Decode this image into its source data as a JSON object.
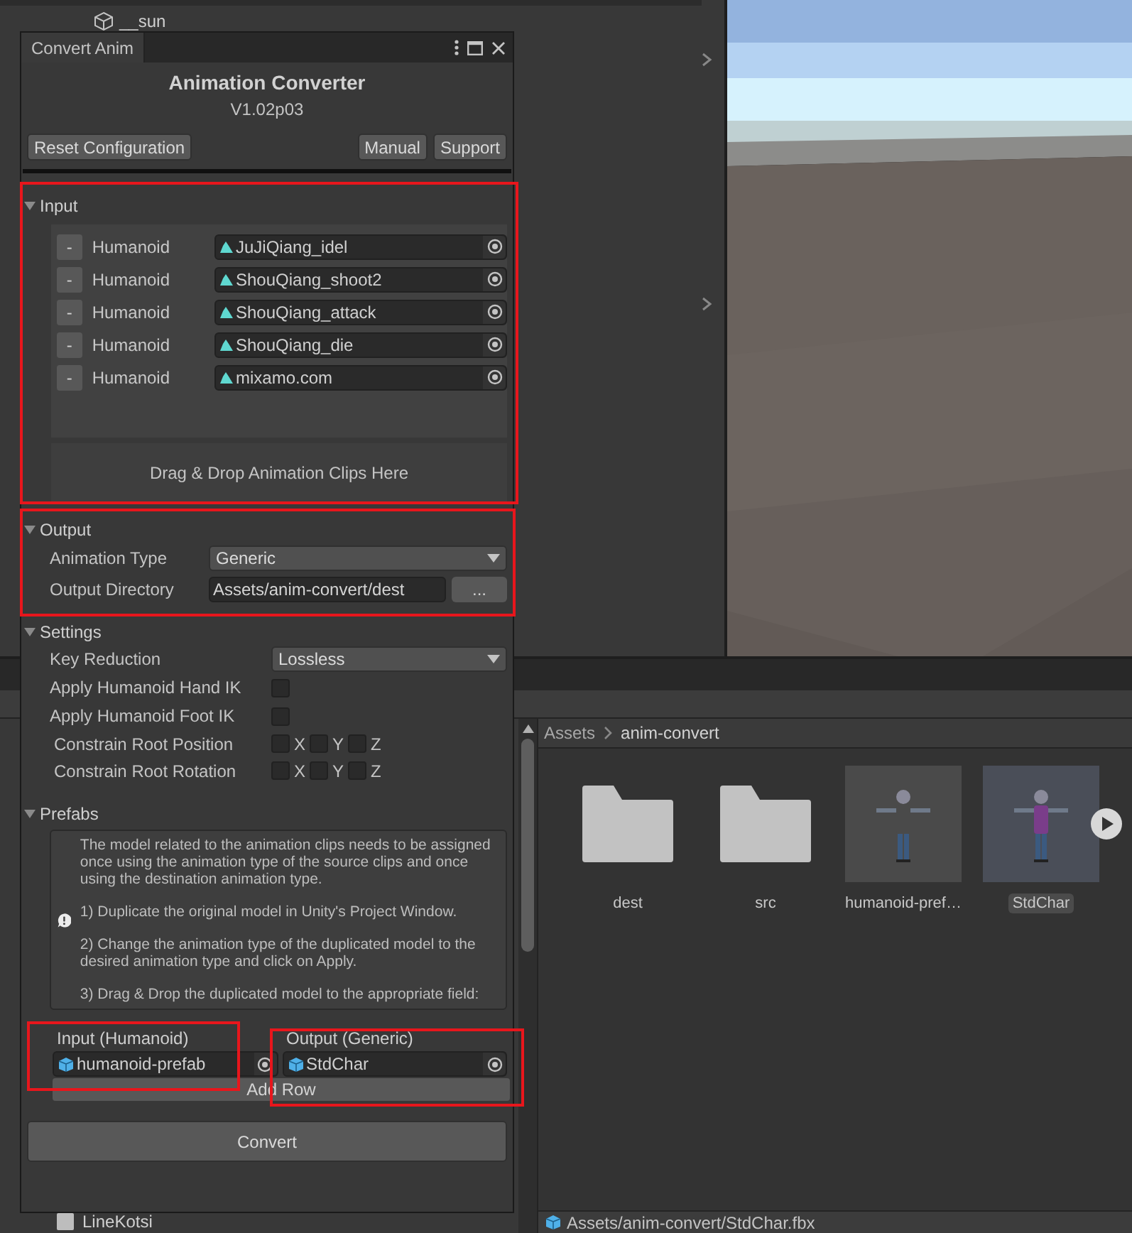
{
  "hierarchy": {
    "items": [
      {
        "label": "__sun"
      }
    ]
  },
  "converter": {
    "tab": "Convert Anim",
    "title": "Animation Converter",
    "version": "V1.02p03",
    "toolbar_left": [
      "Reset Configuration"
    ],
    "toolbar_right": [
      "Manual",
      "Support"
    ],
    "input": {
      "title": "Input",
      "expanded": true,
      "clips": [
        {
          "remove_button": "-",
          "type": "Humanoid",
          "clip": "JuJiQiang_idel"
        },
        {
          "remove_button": "-",
          "type": "Humanoid",
          "clip": "ShouQiang_shoot2"
        },
        {
          "remove_button": "-",
          "type": "Humanoid",
          "clip": "ShouQiang_attack"
        },
        {
          "remove_button": "-",
          "type": "Humanoid",
          "clip": "ShouQiang_die"
        },
        {
          "remove_button": "-",
          "type": "Humanoid",
          "clip": "mixamo.com"
        }
      ],
      "drop_hint": "Drag & Drop Animation Clips Here"
    },
    "output": {
      "title": "Output",
      "expanded": true,
      "rows": [
        {
          "kind": "dropdown",
          "label": "Animation Type",
          "value": "Generic"
        },
        {
          "kind": "path",
          "label": "Output Directory",
          "value": "Assets/anim-convert/dest",
          "button": "..."
        }
      ]
    },
    "settings": {
      "title": "Settings",
      "expanded": true,
      "rows": [
        {
          "kind": "dropdown",
          "label": "Key Reduction",
          "value": "Lossless"
        },
        {
          "kind": "checkbox",
          "label": "Apply Humanoid Hand IK",
          "checked": false
        },
        {
          "kind": "checkbox",
          "label": "Apply Humanoid Foot IK",
          "checked": false
        },
        {
          "kind": "axes",
          "label": "Constrain Root Position",
          "axes": [
            {
              "label": "X",
              "checked": false
            },
            {
              "label": "Y",
              "checked": false
            },
            {
              "label": "Z",
              "checked": false
            }
          ]
        },
        {
          "kind": "axes",
          "label": "Constrain Root Rotation",
          "axes": [
            {
              "label": "X",
              "checked": false
            },
            {
              "label": "Y",
              "checked": false
            },
            {
              "label": "Z",
              "checked": false
            }
          ]
        }
      ]
    },
    "prefabs": {
      "title": "Prefabs",
      "expanded": true,
      "help": [
        "The model related to the animation clips needs to be assigned once using the animation type of the source clips and once using the destination animation type.",
        "1) Duplicate the original model in Unity's Project Window.",
        "2) Change the animation type of the duplicated model to the desired animation type and click on Apply.",
        "3) Drag & Drop the duplicated model to the appropriate field:"
      ],
      "columns": [
        {
          "heading": "Input (Humanoid)",
          "value": "humanoid-prefab"
        },
        {
          "heading": "Output (Generic)",
          "value": "StdChar"
        }
      ],
      "add_row": "Add Row"
    },
    "convert": "Convert"
  },
  "project": {
    "tree": [
      {
        "label": "LineKotsi"
      }
    ],
    "breadcrumb": [
      "Assets",
      "anim-convert"
    ],
    "assets": [
      {
        "name": "dest",
        "kind": "folder",
        "selected": false
      },
      {
        "name": "src",
        "kind": "folder",
        "selected": false
      },
      {
        "name": "humanoid-pref…",
        "kind": "model",
        "selected": false
      },
      {
        "name": "StdChar",
        "kind": "animated_model",
        "selected": true
      }
    ],
    "status_path": "Assets/anim-convert/StdChar.fbx"
  }
}
